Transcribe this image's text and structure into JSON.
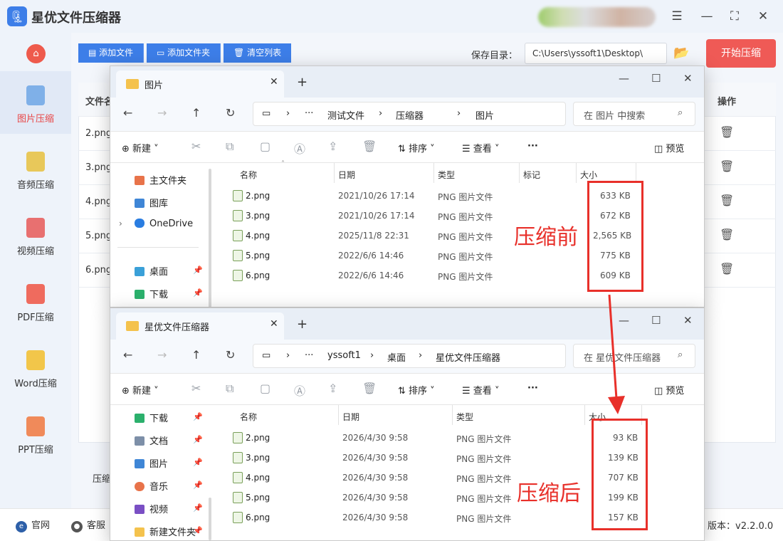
{
  "app": {
    "title": "星优文件压缩器",
    "version_label": "版本：v2.2.0.0"
  },
  "sidebar": {
    "items": [
      {
        "label": "图片压缩",
        "icon": "image-compress-icon",
        "active": true
      },
      {
        "label": "音频压缩",
        "icon": "audio-compress-icon"
      },
      {
        "label": "视频压缩",
        "icon": "video-compress-icon"
      },
      {
        "label": "PDF压缩",
        "icon": "pdf-compress-icon"
      },
      {
        "label": "Word压缩",
        "icon": "word-compress-icon"
      },
      {
        "label": "PPT压缩",
        "icon": "ppt-compress-icon"
      }
    ]
  },
  "toolbar": {
    "add_file": "添加文件",
    "add_folder": "添加文件夹",
    "clear_list": "清空列表",
    "save_label": "保存目录：",
    "save_path": "C:\\Users\\yssoft1\\Desktop\\",
    "start": "开始压缩"
  },
  "main": {
    "header_name": "文件名",
    "header_action": "操作",
    "rows": [
      "2.png",
      "3.png",
      "4.png",
      "5.png",
      "6.png"
    ],
    "bottom_label": "压缩"
  },
  "bottom": {
    "website": "官网",
    "service": "客服"
  },
  "colors": {
    "accent": "#3d7ee8",
    "start_button": "#ef5a56",
    "annotation": "#e8302a"
  },
  "explorer_common": {
    "new": "新建",
    "sort": "排序",
    "view": "查看",
    "preview": "预览",
    "more": "···",
    "col_name": "名称",
    "col_date": "日期",
    "col_type": "类型",
    "col_tag": "标记",
    "col_size": "大小"
  },
  "explorer_top": {
    "tab_title": "图片",
    "breadcrumb": [
      "测试文件",
      "压缩器",
      "图片"
    ],
    "breadcrumb_ellipsis": "···",
    "search_placeholder": "在 图片 中搜索",
    "nav": [
      {
        "label": "主文件夹",
        "icon": "home-icon"
      },
      {
        "label": "图库",
        "icon": "gallery-icon"
      },
      {
        "label": "OneDrive",
        "icon": "onedrive-icon"
      },
      {
        "label": "桌面",
        "icon": "desktop-icon"
      },
      {
        "label": "下载",
        "icon": "download-icon"
      }
    ],
    "files": [
      {
        "name": "2.png",
        "date": "2021/10/26 17:14",
        "type": "PNG 图片文件",
        "size": "633 KB"
      },
      {
        "name": "3.png",
        "date": "2021/10/26 17:14",
        "type": "PNG 图片文件",
        "size": "672 KB"
      },
      {
        "name": "4.png",
        "date": "2025/11/8 22:31",
        "type": "PNG 图片文件",
        "size": "2,565 KB"
      },
      {
        "name": "5.png",
        "date": "2022/6/6 14:46",
        "type": "PNG 图片文件",
        "size": "775 KB"
      },
      {
        "name": "6.png",
        "date": "2022/6/6 14:46",
        "type": "PNG 图片文件",
        "size": "609 KB"
      }
    ],
    "annotation": "压缩前"
  },
  "explorer_bottom": {
    "tab_title": "星优文件压缩器",
    "breadcrumb": [
      "yssoft1",
      "桌面",
      "星优文件压缩器"
    ],
    "breadcrumb_ellipsis": "···",
    "search_placeholder": "在 星优文件压缩器",
    "nav": [
      {
        "label": "下载",
        "icon": "download-icon"
      },
      {
        "label": "文档",
        "icon": "document-icon"
      },
      {
        "label": "图片",
        "icon": "picture-icon"
      },
      {
        "label": "音乐",
        "icon": "music-icon"
      },
      {
        "label": "视频",
        "icon": "video-icon"
      },
      {
        "label": "新建文件夹",
        "icon": "folder-icon"
      }
    ],
    "files": [
      {
        "name": "2.png",
        "date": "2026/4/30 9:58",
        "type": "PNG 图片文件",
        "size": "93 KB"
      },
      {
        "name": "3.png",
        "date": "2026/4/30 9:58",
        "type": "PNG 图片文件",
        "size": "139 KB"
      },
      {
        "name": "4.png",
        "date": "2026/4/30 9:58",
        "type": "PNG 图片文件",
        "size": "707 KB"
      },
      {
        "name": "5.png",
        "date": "2026/4/30 9:58",
        "type": "PNG 图片文件",
        "size": "199 KB"
      },
      {
        "name": "6.png",
        "date": "2026/4/30 9:58",
        "type": "PNG 图片文件",
        "size": "157 KB"
      }
    ],
    "annotation": "压缩后"
  }
}
